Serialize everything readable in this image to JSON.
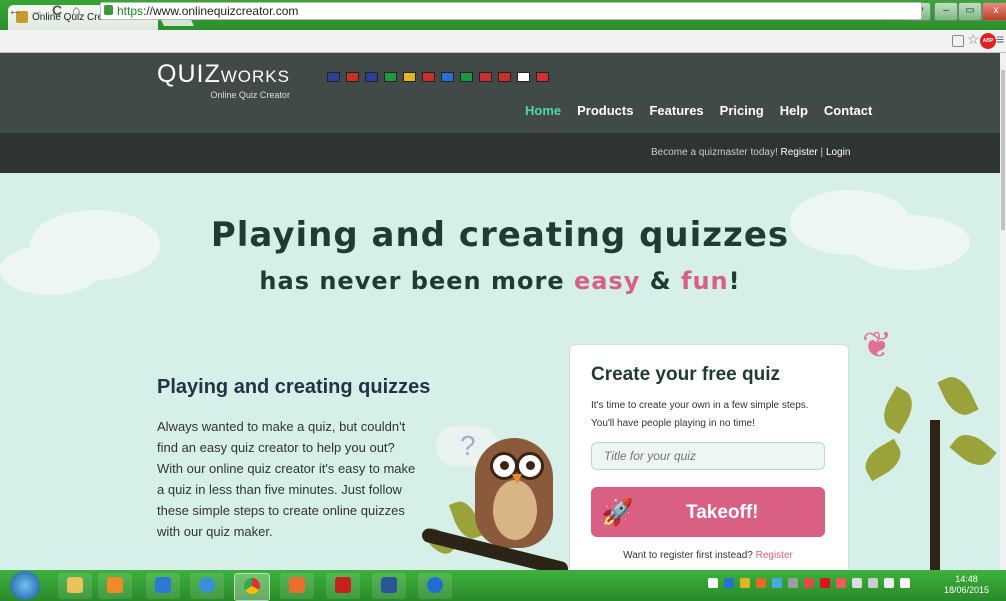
{
  "browser": {
    "tab_title": "Online Quiz Creator: Play",
    "tab_close": "×",
    "url_scheme": "https",
    "url_rest": "://www.onlinequizcreator.com",
    "window_buttons": {
      "user": "By",
      "minimize": "–",
      "maximize": "▭",
      "close": "x"
    },
    "nav_icons": {
      "back": "←",
      "forward": "→",
      "reload": "C",
      "home": "⌂"
    },
    "abp_label": "ABP"
  },
  "site": {
    "logo_main": "QUIZ",
    "logo_small": "WORKS",
    "logo_tagline": "Online Quiz Creator",
    "flags": [
      {
        "name": "english",
        "color": "#2d3e9a"
      },
      {
        "name": "dutch",
        "color": "#c9302c"
      },
      {
        "name": "french",
        "color": "#2d3e9a"
      },
      {
        "name": "italian",
        "color": "#1a9a3a"
      },
      {
        "name": "german",
        "color": "#e2b623"
      },
      {
        "name": "spanish",
        "color": "#c9302c"
      },
      {
        "name": "finnish",
        "color": "#2d6ed3"
      },
      {
        "name": "portuguese",
        "color": "#1a9a3a"
      },
      {
        "name": "danish",
        "color": "#c9302c"
      },
      {
        "name": "norwegian",
        "color": "#c9302c"
      },
      {
        "name": "japanese",
        "color": "#ffffff"
      },
      {
        "name": "chinese",
        "color": "#d32f2f"
      }
    ],
    "nav": [
      "Home",
      "Products",
      "Features",
      "Pricing",
      "Help",
      "Contact"
    ],
    "auth_prompt": "Become a quizmaster today!",
    "auth_register": "Register",
    "auth_sep": "|",
    "auth_login": "Login"
  },
  "hero": {
    "title": "Playing and creating quizzes",
    "sub_prefix": "has never been more",
    "sub_easy": "easy",
    "sub_amp": "&",
    "sub_fun": "fun",
    "sub_end": "!"
  },
  "intro": {
    "heading": "Playing and creating quizzes",
    "text": "Always wanted to make a quiz, but couldn't find an easy quiz creator to help you out? With our online quiz creator it's easy to make a quiz in less than five minutes. Just follow these simple steps to create online quizzes with our quiz maker."
  },
  "card": {
    "title": "Create your free quiz",
    "desc": "It's time to create your own in a few simple steps. You'll have people playing in no time!",
    "input_placeholder": "Title for your quiz",
    "button_label": "Takeoff!",
    "register_prompt": "Want to register first instead?",
    "register_link": "Register"
  },
  "colors": {
    "accent_pink": "#d95f83",
    "accent_green": "#51d6a6",
    "header_bg": "#414a46"
  },
  "taskbar": {
    "clock_time": "14:48",
    "clock_date": "18/06/2015",
    "apps": [
      "file-explorer",
      "media-player",
      "dropbox",
      "disc-utility",
      "chrome",
      "outlook",
      "acrobat",
      "word",
      "teamviewer"
    ]
  }
}
